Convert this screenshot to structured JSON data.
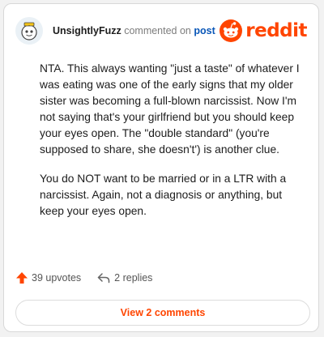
{
  "comment": {
    "author": "UnsightlyFuzz",
    "action_text": "commented on",
    "post_link": "post",
    "paragraphs": [
      "NTA. This always wanting \"just a taste\" of whatever I was eating was one of the early signs that my older sister was becoming a full-blown narcissist. Now I'm not saying that's your girlfriend but you should keep your eyes open. The \"double standard\" (you're supposed to share, she doesn't') is another clue.",
      "You do NOT want to be married or in a LTR with a narcissist. Again, not a diagnosis or anything, but keep your eyes open."
    ],
    "upvotes_label": "39 upvotes",
    "replies_label": "2 replies"
  },
  "brand": {
    "wordmark": "reddit",
    "color": "#ff4500"
  },
  "actions": {
    "view_comments_label": "View 2 comments"
  },
  "colors": {
    "accent": "#ff4500",
    "link": "#0a57b8",
    "muted": "#7c7c7c"
  },
  "icons": {
    "avatar": "snoo-avatar-icon",
    "logo": "reddit-snoo-icon",
    "upvote": "upvote-arrow-icon",
    "reply": "reply-arrow-icon"
  }
}
